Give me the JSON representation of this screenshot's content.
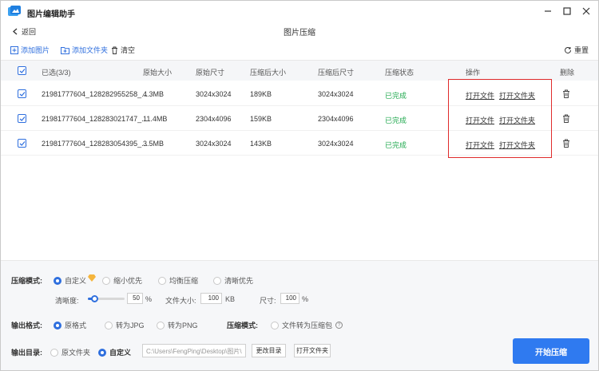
{
  "app": {
    "title": "图片编辑助手"
  },
  "nav": {
    "back_label": "返回",
    "page_title": "图片压缩"
  },
  "toolbar": {
    "add_image": "添加图片",
    "add_folder": "添加文件夹",
    "clear": "清空",
    "reset": "重置"
  },
  "table": {
    "headers": {
      "selected": "已选(3/3)",
      "orig_size": "原始大小",
      "orig_dim": "原始尺寸",
      "comp_size": "压缩后大小",
      "comp_dim": "压缩后尺寸",
      "status": "压缩状态",
      "actions": "操作",
      "delete": "删除"
    },
    "rows": [
      {
        "name": "21981777604_128282955258_...",
        "orig_size": "4.3MB",
        "orig_dim": "3024x3024",
        "comp_size": "189KB",
        "comp_dim": "3024x3024",
        "status": "已完成",
        "open_file": "打开文件",
        "open_folder": "打开文件夹"
      },
      {
        "name": "21981777604_128283021747_...",
        "orig_size": "11.4MB",
        "orig_dim": "2304x4096",
        "comp_size": "159KB",
        "comp_dim": "2304x4096",
        "status": "已完成",
        "open_file": "打开文件",
        "open_folder": "打开文件夹"
      },
      {
        "name": "21981777604_128283054395_...",
        "orig_size": "3.5MB",
        "orig_dim": "3024x3024",
        "comp_size": "143KB",
        "comp_dim": "3024x3024",
        "status": "已完成",
        "open_file": "打开文件",
        "open_folder": "打开文件夹"
      }
    ]
  },
  "settings": {
    "mode_label": "压缩模式:",
    "mode_options": [
      "自定义",
      "缩小优先",
      "均衡压缩",
      "清晰优先"
    ],
    "clarity_label": "清晰度:",
    "clarity_value": "50",
    "clarity_percent": 50,
    "percent": "%",
    "filesize_label": "文件大小:",
    "filesize_value": "100",
    "filesize_unit": "KB",
    "dim_label": "尺寸:",
    "dim_value": "100",
    "format_label": "输出格式:",
    "format_options": [
      "原格式",
      "转为JPG",
      "转为PNG"
    ],
    "pack_label": "压缩模式:",
    "pack_option": "文件转为压缩包",
    "output_label": "输出目录:",
    "output_options": [
      "原文件夹",
      "自定义"
    ],
    "output_path": "C:\\Users\\FengPing\\Desktop\\图片\\",
    "change_dir": "更改目录",
    "open_folder": "打开文件夹",
    "start": "开始压缩"
  }
}
